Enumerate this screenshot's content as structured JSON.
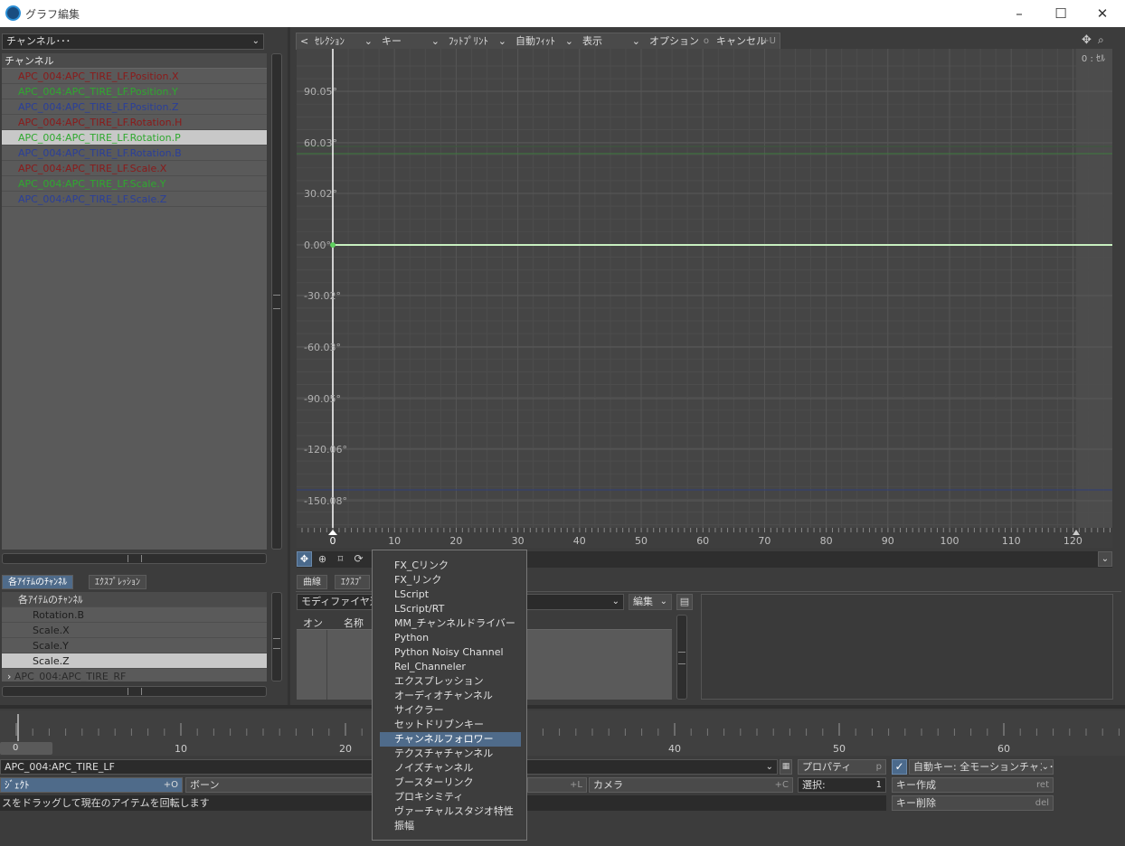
{
  "window": {
    "title": "グラフ編集",
    "minimize": "–",
    "maximize": "☐",
    "close": "✕"
  },
  "left_panel": {
    "channel_dropdown": "チャンネル･･･",
    "list_header": "チャンネル",
    "channels": [
      {
        "label": "APC_004:APC_TIRE_LF.Position.X",
        "color": "red"
      },
      {
        "label": "APC_004:APC_TIRE_LF.Position.Y",
        "color": "green"
      },
      {
        "label": "APC_004:APC_TIRE_LF.Position.Z",
        "color": "blue"
      },
      {
        "label": "APC_004:APC_TIRE_LF.Rotation.H",
        "color": "red"
      },
      {
        "label": "APC_004:APC_TIRE_LF.Rotation.P",
        "color": "green"
      },
      {
        "label": "APC_004:APC_TIRE_LF.Rotation.B",
        "color": "blue"
      },
      {
        "label": "APC_004:APC_TIRE_LF.Scale.X",
        "color": "red"
      },
      {
        "label": "APC_004:APC_TIRE_LF.Scale.Y",
        "color": "green"
      },
      {
        "label": "APC_004:APC_TIRE_LF.Scale.Z",
        "color": "blue"
      }
    ],
    "tabs": [
      "各ｱｲﾃﾑのﾁｬﾝﾈﾙ",
      "ｴｸｽﾌﾟﾚｯｼｮﾝ"
    ],
    "tree_header": "各ｱｲﾃﾑのﾁｬﾝﾈﾙ",
    "tree_items": [
      "Rotation.B",
      "Scale.X",
      "Scale.Y",
      "Scale.Z"
    ],
    "tree_group": "APC_004:APC_TIRE_RF"
  },
  "toolbar": {
    "back": "<",
    "selection": "ｾﾚｸｼｮﾝ",
    "key": "キー",
    "footprint": "ﾌｯﾄﾌﾟﾘﾝﾄ",
    "autofit": "自動ﾌｨｯﾄ",
    "display": "表示",
    "options": "オプション",
    "options_hotkey": "o",
    "cancel": "キャンセル",
    "cancel_hotkey": "+U"
  },
  "graph": {
    "corner_label": "0 : ｾﾙ",
    "y_labels": [
      "90.05°",
      "60.03°",
      "30.02°",
      "0.00°",
      "-30.02°",
      "-60.03°",
      "-90.05°",
      "-120.06°",
      "-150.08°"
    ],
    "x_labels": [
      "0",
      "10",
      "20",
      "30",
      "40",
      "50",
      "60",
      "70",
      "80",
      "90",
      "100",
      "110",
      "120"
    ]
  },
  "bottom_tabs": [
    "曲線",
    "ｴｸｽﾌﾟ"
  ],
  "modifier": {
    "add_label": "モディファイヤ追加",
    "edit": "編集",
    "col_on": "オン",
    "col_name": "名称"
  },
  "popup_menu": {
    "items": [
      "FX_Cリンク",
      "FX_リンク",
      "LScript",
      "LScript/RT",
      "MM_チャンネルドライバー",
      "Python",
      "Python Noisy Channel",
      "Rel_Channeler",
      "エクスプレッション",
      "オーディオチャンネル",
      "サイクラー",
      "セットドリブンキー",
      "チャンネルフォロワー",
      "テクスチャチャンネル",
      "ノイズチャンネル",
      "ブースターリンク",
      "プロキシミティ",
      "ヴァーチャルスタジオ特性",
      "振幅"
    ],
    "highlighted": "チャンネルフォロワー"
  },
  "timeline": {
    "labels": [
      "0",
      "10",
      "20",
      "40",
      "50",
      "60"
    ],
    "current_frame": "0"
  },
  "status": {
    "item_field": "APC_004:APC_TIRE_LF",
    "object_tab": "ｼﾞｪｸﾄ",
    "object_hotkey": "+O",
    "bone_tab": "ボーン",
    "bone_hotkey": "+",
    "light_hotkey": "+L",
    "camera_tab": "カメラ",
    "camera_hotkey": "+C",
    "properties": "プロパティ",
    "properties_hotkey": "p",
    "selection_label": "選択:",
    "selection_count": "1",
    "autokey": "自動キー: 全モーションチャン･･･",
    "create_key": "キー作成",
    "create_key_hotkey": "ret",
    "delete_key": "キー削除",
    "delete_key_hotkey": "del",
    "hint": "スをドラッグして現在のアイテムを回転します"
  },
  "colors": {
    "accent": "#4f6b8a",
    "graph_bg": "#454545",
    "curve": "#c8f0c0"
  }
}
